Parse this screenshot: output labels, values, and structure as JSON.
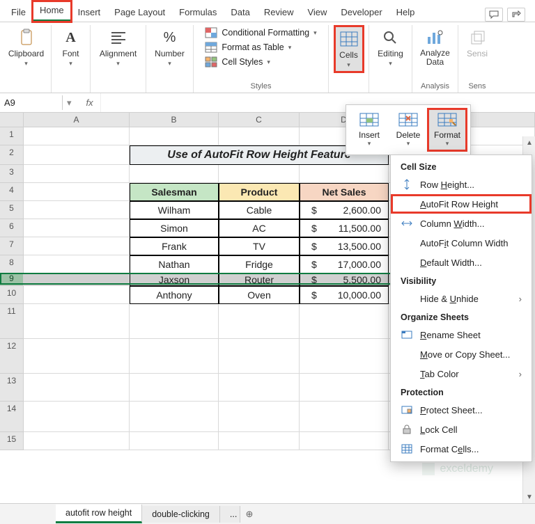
{
  "tabs": {
    "file": "File",
    "home": "Home",
    "insert": "Insert",
    "page_layout": "Page Layout",
    "formulas": "Formulas",
    "data": "Data",
    "review": "Review",
    "view": "View",
    "developer": "Developer",
    "help": "Help"
  },
  "ribbon": {
    "clipboard": "Clipboard",
    "font": "Font",
    "alignment": "Alignment",
    "number": "Number",
    "styles_label": "Styles",
    "cond_fmt": "Conditional Formatting",
    "fmt_table": "Format as Table",
    "cell_styles": "Cell Styles",
    "cells": "Cells",
    "editing": "Editing",
    "analyze": "Analyze Data",
    "analysis": "Analysis",
    "sensi": "Sensi",
    "sens": "Sens"
  },
  "namebox": "A9",
  "sheet": {
    "cols": [
      "A",
      "B",
      "C",
      "D"
    ],
    "title": "Use of AutoFit Row Height Feature",
    "headers": [
      "Salesman",
      "Product",
      "Net Sales"
    ],
    "rows": [
      {
        "r": "5",
        "s": "Wilham",
        "p": "Cable",
        "n": "2,600.00"
      },
      {
        "r": "6",
        "s": "Simon",
        "p": "AC",
        "n": "11,500.00"
      },
      {
        "r": "7",
        "s": "Frank",
        "p": "TV",
        "n": "13,500.00"
      },
      {
        "r": "8",
        "s": "Nathan",
        "p": "Fridge",
        "n": "17,000.00"
      },
      {
        "r": "9",
        "s": "Jaxson",
        "p": "Router",
        "n": "5,500.00"
      },
      {
        "r": "10",
        "s": "Anthony",
        "p": "Oven",
        "n": "10,000.00"
      }
    ],
    "extra_rows": [
      "11",
      "12",
      "13",
      "14",
      "15"
    ]
  },
  "cells_popup": {
    "insert": "Insert",
    "delete": "Delete",
    "format": "Format"
  },
  "format_menu": {
    "cell_size": "Cell Size",
    "row_height": "Row Height...",
    "autofit_row": "AutoFit Row Height",
    "col_width": "Column Width...",
    "autofit_col": "AutoFit Column Width",
    "default_width": "Default Width...",
    "visibility": "Visibility",
    "hide_unhide": "Hide & Unhide",
    "organize": "Organize Sheets",
    "rename": "Rename Sheet",
    "move_copy": "Move or Copy Sheet...",
    "tab_color": "Tab Color",
    "protection": "Protection",
    "protect_sheet": "Protect Sheet...",
    "lock_cell": "Lock Cell",
    "format_cells": "Format Cells..."
  },
  "sheet_tabs": {
    "t1": "autofit row height",
    "t2": "double-clicking",
    "more": "..."
  },
  "watermark": "exceldemy"
}
